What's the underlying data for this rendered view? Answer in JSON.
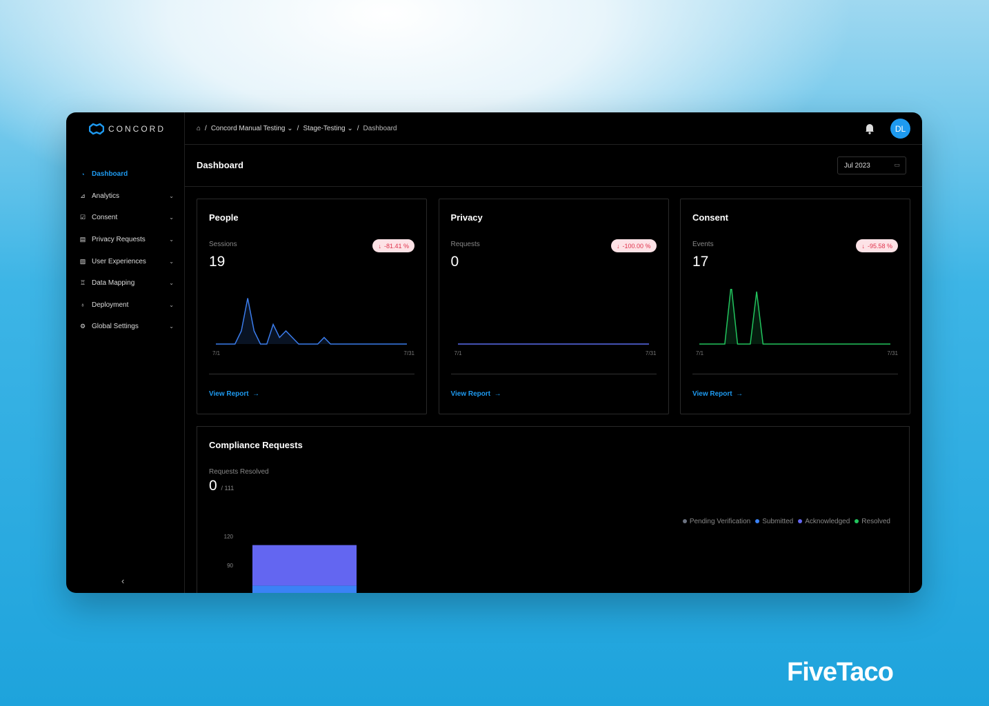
{
  "brand": "CONCORD",
  "sidebar": {
    "items": [
      {
        "label": "Dashboard",
        "icon": "gauge-icon",
        "active": true
      },
      {
        "label": "Analytics",
        "icon": "chart-icon"
      },
      {
        "label": "Consent",
        "icon": "checkbox-icon"
      },
      {
        "label": "Privacy Requests",
        "icon": "document-icon"
      },
      {
        "label": "User Experiences",
        "icon": "image-icon"
      },
      {
        "label": "Data Mapping",
        "icon": "hierarchy-icon"
      },
      {
        "label": "Deployment",
        "icon": "rocket-icon"
      },
      {
        "label": "Global Settings",
        "icon": "gear-icon"
      }
    ]
  },
  "breadcrumb": {
    "org": "Concord Manual Testing",
    "env": "Stage-Testing",
    "page": "Dashboard"
  },
  "user": {
    "initials": "DL"
  },
  "header": {
    "title": "Dashboard",
    "date": "Jul 2023"
  },
  "cards": [
    {
      "title": "People",
      "label": "Sessions",
      "value": "19",
      "change": "-81.41 %",
      "x_start": "7/1",
      "x_end": "7/31",
      "link": "View Report",
      "color": "#3b7ded"
    },
    {
      "title": "Privacy",
      "label": "Requests",
      "value": "0",
      "change": "-100.00 %",
      "x_start": "7/1",
      "x_end": "7/31",
      "link": "View Report",
      "color": "#5b6ef0"
    },
    {
      "title": "Consent",
      "label": "Events",
      "value": "17",
      "change": "-95.58 %",
      "x_start": "7/1",
      "x_end": "7/31",
      "link": "View Report",
      "color": "#22c55e"
    }
  ],
  "chart_data": [
    {
      "type": "line",
      "title": "People",
      "x": [
        "7/1",
        "7/31"
      ],
      "values": [
        0,
        0,
        0,
        0,
        2,
        7,
        2,
        0,
        0,
        3,
        1,
        2,
        1,
        0,
        0,
        0,
        0,
        1,
        0,
        0,
        0,
        0,
        0,
        0,
        0,
        0,
        0,
        0,
        0,
        0,
        0
      ]
    },
    {
      "type": "line",
      "title": "Privacy",
      "x": [
        "7/1",
        "7/31"
      ],
      "values": [
        0,
        0,
        0,
        0,
        0,
        0,
        0,
        0,
        0,
        0,
        0,
        0,
        0,
        0,
        0,
        0,
        0,
        0,
        0,
        0,
        0,
        0,
        0,
        0,
        0,
        0,
        0,
        0,
        0,
        0,
        0
      ]
    },
    {
      "type": "line",
      "title": "Consent",
      "x": [
        "7/1",
        "7/31"
      ],
      "values": [
        0,
        0,
        0,
        0,
        0,
        9,
        0,
        0,
        0,
        8,
        0,
        0,
        0,
        0,
        0,
        0,
        0,
        0,
        0,
        0,
        0,
        0,
        0,
        0,
        0,
        0,
        0,
        0,
        0,
        0,
        0
      ]
    },
    {
      "type": "bar",
      "title": "Compliance Requests",
      "yticks": [
        120,
        90
      ],
      "series": [
        {
          "name": "Submitted",
          "value": 69,
          "color": "#3b82f6"
        },
        {
          "name": "Acknowledged",
          "value": 42,
          "color": "#6366f1"
        }
      ]
    }
  ],
  "compliance": {
    "title": "Compliance Requests",
    "label": "Requests Resolved",
    "resolved": "0",
    "total": "/ 111",
    "legend": [
      {
        "name": "Pending Verification",
        "color": "#6b7280"
      },
      {
        "name": "Submitted",
        "color": "#3b82f6"
      },
      {
        "name": "Acknowledged",
        "color": "#6366f1"
      },
      {
        "name": "Resolved",
        "color": "#22c55e"
      }
    ],
    "yticks": [
      "120",
      "90"
    ]
  },
  "watermark": "FiveTaco"
}
